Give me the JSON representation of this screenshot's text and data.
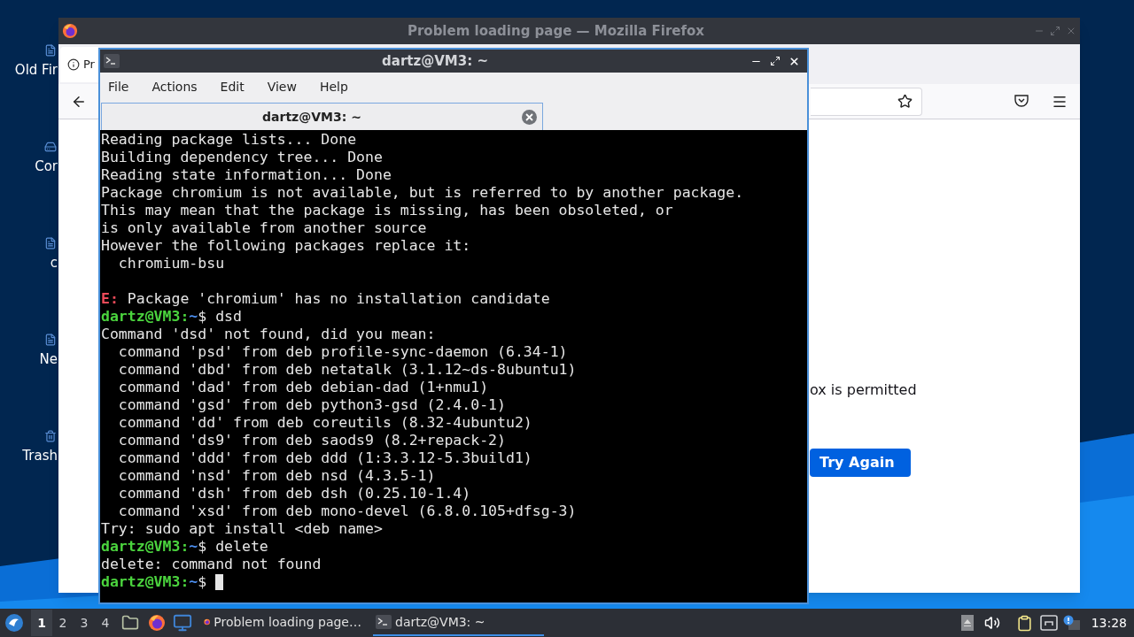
{
  "desktop": {
    "icons": [
      {
        "label": "Old Fir",
        "kind": "file"
      },
      {
        "label": "Cor",
        "kind": "computer"
      },
      {
        "label": "c",
        "kind": "file"
      },
      {
        "label": "Ne",
        "kind": "file"
      },
      {
        "label": "Trash",
        "kind": "trash"
      }
    ]
  },
  "firefox": {
    "title": "Problem loading page — Mozilla Firefox",
    "tab": "Pr",
    "message": "ox is permitted",
    "button": "Try Again"
  },
  "terminal": {
    "title": "dartz@VM3: ~",
    "menu": [
      "File",
      "Actions",
      "Edit",
      "View",
      "Help"
    ],
    "tab": "dartz@VM3: ~",
    "lines": [
      {
        "kind": "output",
        "text": "Reading package lists... Done"
      },
      {
        "kind": "output",
        "text": "Building dependency tree... Done"
      },
      {
        "kind": "output",
        "text": "Reading state information... Done"
      },
      {
        "kind": "output",
        "text": "Package chromium is not available, but is referred to by another package."
      },
      {
        "kind": "output",
        "text": "This may mean that the package is missing, has been obsoleted, or"
      },
      {
        "kind": "output",
        "text": "is only available from another source"
      },
      {
        "kind": "output",
        "text": "However the following packages replace it:"
      },
      {
        "kind": "output",
        "text": "  chromium-bsu"
      },
      {
        "kind": "blank"
      },
      {
        "kind": "error",
        "label": "E:",
        "text": "Package 'chromium' has no installation candidate"
      },
      {
        "kind": "prompt",
        "user": "dartz@VM3:",
        "path": "~",
        "symbol": "$",
        "command": "dsd",
        "cursor": false
      },
      {
        "kind": "output",
        "text": "Command 'dsd' not found, did you mean:"
      },
      {
        "kind": "output",
        "text": "  command 'psd' from deb profile-sync-daemon (6.34-1)"
      },
      {
        "kind": "output",
        "text": "  command 'dbd' from deb netatalk (3.1.12~ds-8ubuntu1)"
      },
      {
        "kind": "output",
        "text": "  command 'dad' from deb debian-dad (1+nmu1)"
      },
      {
        "kind": "output",
        "text": "  command 'gsd' from deb python3-gsd (2.4.0-1)"
      },
      {
        "kind": "output",
        "text": "  command 'dd' from deb coreutils (8.32-4ubuntu2)"
      },
      {
        "kind": "output",
        "text": "  command 'ds9' from deb saods9 (8.2+repack-2)"
      },
      {
        "kind": "output",
        "text": "  command 'ddd' from deb ddd (1:3.3.12-5.3build1)"
      },
      {
        "kind": "output",
        "text": "  command 'nsd' from deb nsd (4.3.5-1)"
      },
      {
        "kind": "output",
        "text": "  command 'dsh' from deb dsh (0.25.10-1.4)"
      },
      {
        "kind": "output",
        "text": "  command 'xsd' from deb mono-devel (6.8.0.105+dfsg-3)"
      },
      {
        "kind": "output",
        "text": "Try: sudo apt install <deb name>"
      },
      {
        "kind": "prompt",
        "user": "dartz@VM3:",
        "path": "~",
        "symbol": "$",
        "command": "delete",
        "cursor": false
      },
      {
        "kind": "output",
        "text": "delete: command not found"
      },
      {
        "kind": "prompt",
        "user": "dartz@VM3:",
        "path": "~",
        "symbol": "$",
        "cursor": true
      }
    ]
  },
  "taskbar": {
    "workspaces": [
      {
        "label": "1",
        "selected": true
      },
      {
        "label": "2",
        "selected": false
      },
      {
        "label": "3",
        "selected": false
      },
      {
        "label": "4",
        "selected": false
      }
    ],
    "tasks": [
      {
        "label": "Problem loading page…",
        "kind": "browser",
        "selected": false
      },
      {
        "label": "dartz@VM3: ~",
        "kind": "terminal",
        "selected": true
      }
    ],
    "clock": "13:28"
  }
}
